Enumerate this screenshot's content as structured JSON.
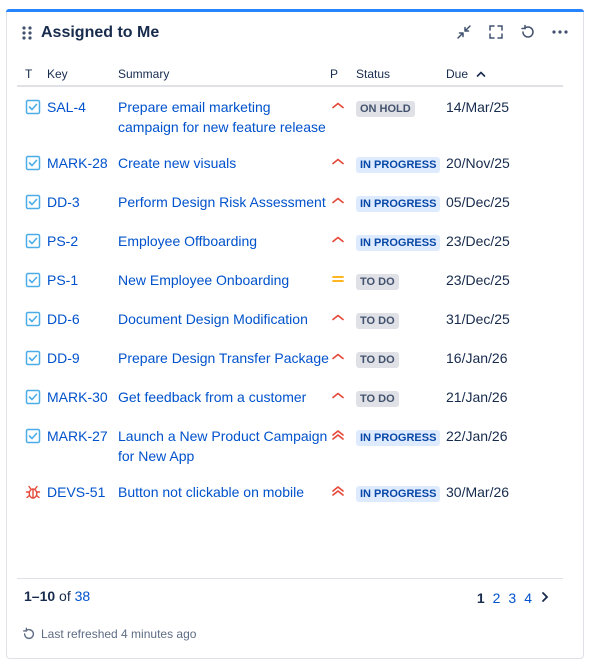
{
  "gadget": {
    "title": "Assigned to Me",
    "actions": [
      "minimize-icon",
      "fullscreen-icon",
      "refresh-icon",
      "more-icon"
    ]
  },
  "columns": {
    "t": "T",
    "key": "Key",
    "summary": "Summary",
    "p": "P",
    "status": "Status",
    "due": "Due"
  },
  "rows": [
    {
      "type": "task",
      "key": "SAL-4",
      "summary": "Prepare email marketing campaign for new feature release",
      "priority": "medium-high",
      "status": "ON HOLD",
      "status_kind": "hold",
      "due": "14/Mar/25"
    },
    {
      "type": "task",
      "key": "MARK-28",
      "summary": "Create new visuals",
      "priority": "medium-high",
      "status": "IN PROGRESS",
      "status_kind": "prog",
      "due": "20/Nov/25"
    },
    {
      "type": "task",
      "key": "DD-3",
      "summary": "Perform Design Risk Assessment",
      "priority": "medium-high",
      "status": "IN PROGRESS",
      "status_kind": "prog",
      "due": "05/Dec/25"
    },
    {
      "type": "task",
      "key": "PS-2",
      "summary": "Employee Offboarding",
      "priority": "medium-high",
      "status": "IN PROGRESS",
      "status_kind": "prog",
      "due": "23/Dec/25"
    },
    {
      "type": "task",
      "key": "PS-1",
      "summary": "New Employee Onboarding",
      "priority": "medium",
      "status": "TO DO",
      "status_kind": "todo",
      "due": "23/Dec/25"
    },
    {
      "type": "task",
      "key": "DD-6",
      "summary": "Document Design Modification",
      "priority": "medium-high",
      "status": "TO DO",
      "status_kind": "todo",
      "due": "31/Dec/25"
    },
    {
      "type": "task",
      "key": "DD-9",
      "summary": "Prepare Design Transfer Package",
      "priority": "medium-high",
      "status": "TO DO",
      "status_kind": "todo",
      "due": "16/Jan/26"
    },
    {
      "type": "task",
      "key": "MARK-30",
      "summary": "Get feedback from a customer",
      "priority": "medium-high",
      "status": "TO DO",
      "status_kind": "todo",
      "due": "21/Jan/26"
    },
    {
      "type": "task",
      "key": "MARK-27",
      "summary": "Launch a New Product Campaign for New App",
      "priority": "high",
      "status": "IN PROGRESS",
      "status_kind": "prog",
      "due": "22/Jan/26"
    },
    {
      "type": "bug",
      "key": "DEVS-51",
      "summary": "Button not clickable on mobile",
      "priority": "high",
      "status": "IN PROGRESS",
      "status_kind": "prog",
      "due": "30/Mar/26"
    }
  ],
  "footer": {
    "range": "1–10",
    "of": "of",
    "total": "38",
    "pages": [
      "1",
      "2",
      "3",
      "4"
    ],
    "current_page": "1"
  },
  "refresh_text": "Last refreshed 4 minutes ago",
  "colors": {
    "accent": "#2684ff",
    "link": "#0052cc",
    "priority": "#e5493a",
    "priority_medium": "#ffab00",
    "task": "#4bade8",
    "bug": "#e5493a"
  }
}
